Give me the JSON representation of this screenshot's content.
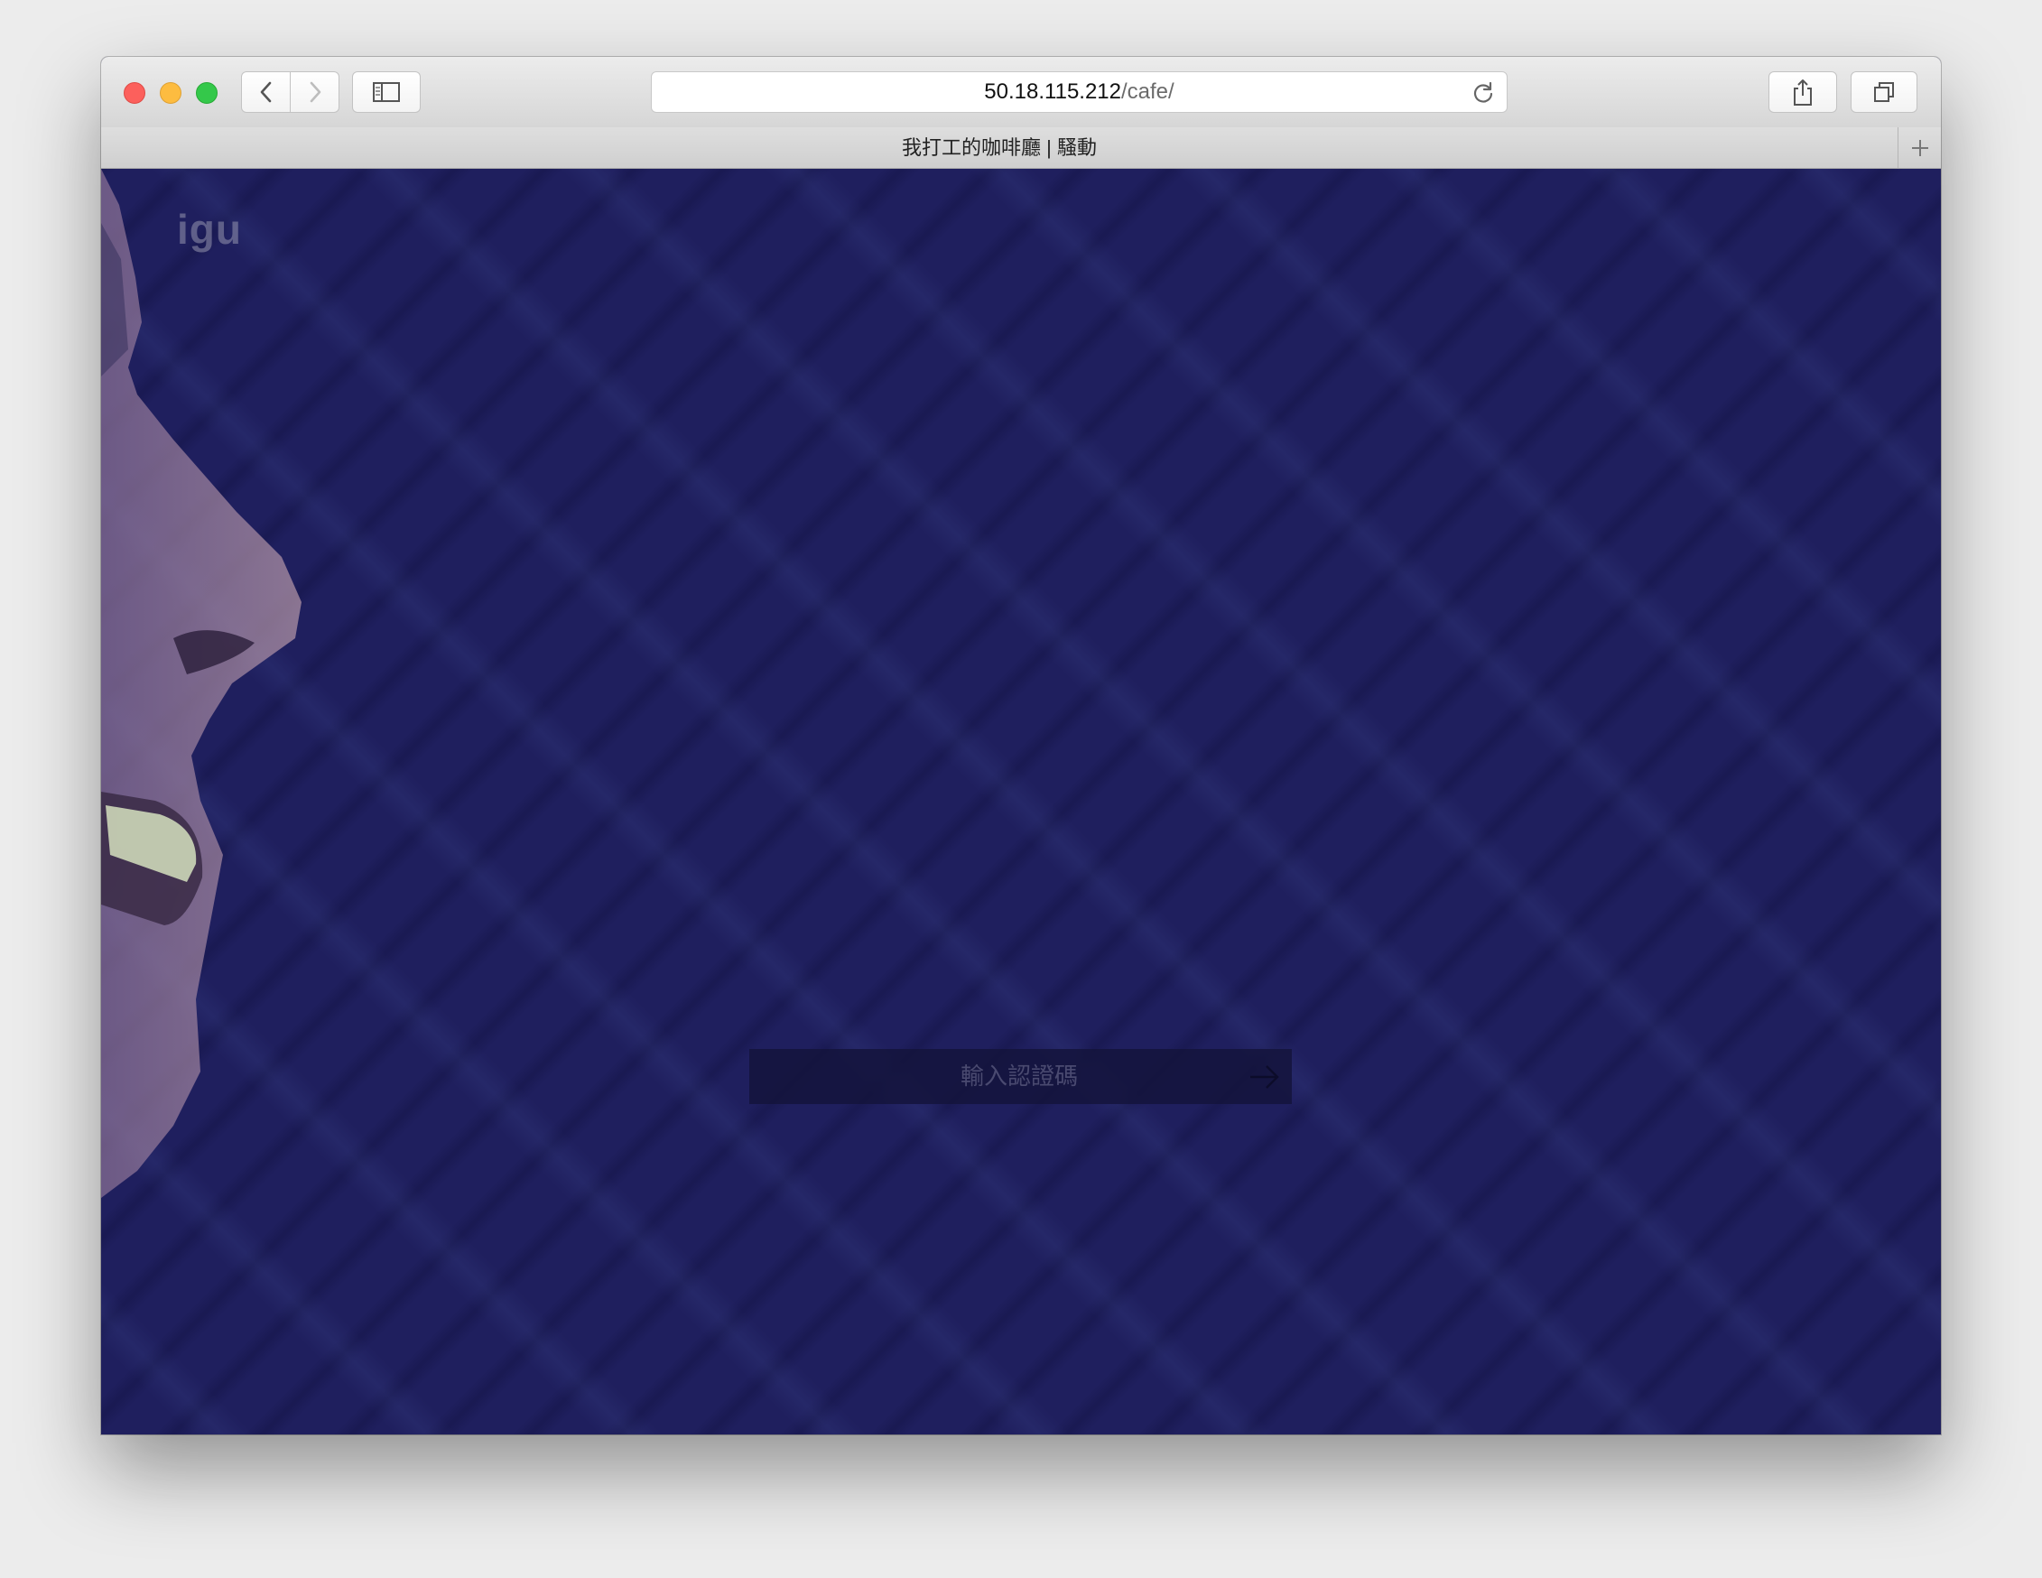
{
  "browser": {
    "address": {
      "host": "50.18.115.212",
      "path": "/cafe/"
    },
    "tab": {
      "title": "我打工的咖啡廳 | 騷動"
    },
    "icons": {
      "close": "close-button",
      "minimize": "minimize-button",
      "zoom": "zoom-button",
      "back": "chevron-left-icon",
      "forward": "chevron-right-icon",
      "sidebar": "sidebar-icon",
      "reload": "reload-icon",
      "share": "share-icon",
      "tabs": "tabs-overview-icon",
      "new_tab": "plus-icon"
    }
  },
  "page": {
    "logo": "igu",
    "code_form": {
      "placeholder": "輸入認證碼",
      "value": "",
      "submit_icon": "arrow-right-icon"
    },
    "colors": {
      "background": "#1f1f5e"
    }
  }
}
